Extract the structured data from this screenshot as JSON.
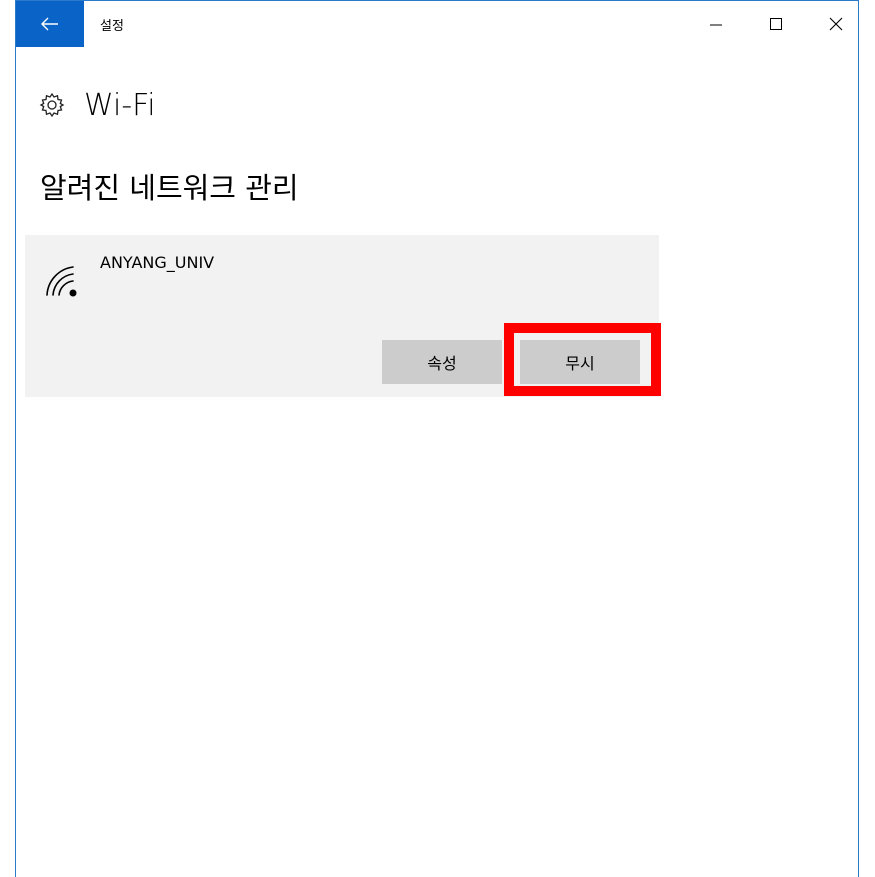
{
  "titlebar": {
    "title": "설정",
    "back_icon": "arrow-left-icon",
    "minimize_icon": "minimize-icon",
    "maximize_icon": "maximize-icon",
    "close_icon": "close-icon",
    "accent_color": "#0a64c8"
  },
  "header": {
    "icon": "gear-icon",
    "title": "Wi-Fi"
  },
  "section": {
    "title": "알려진 네트워크 관리"
  },
  "networks": [
    {
      "name": "ANYANG_UNIV",
      "icon": "wifi-signal-icon",
      "properties_label": "속성",
      "forget_label": "무시"
    }
  ],
  "annotation": {
    "highlight_color": "#ff0000"
  }
}
